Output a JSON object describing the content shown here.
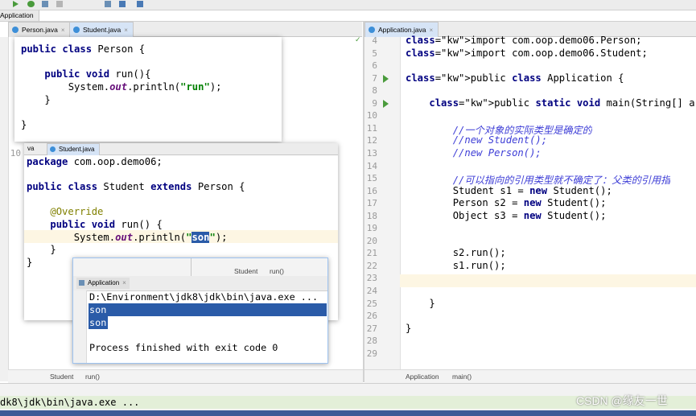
{
  "toolbar": {
    "app_label": "Application"
  },
  "left_tabs": [
    "Person.java",
    "Student.java"
  ],
  "right_tab": "Application.java",
  "person_popup": {
    "lines": [
      "public class Person {",
      "",
      "    public void run(){",
      "        System.out.println(\"run\");",
      "    }",
      "",
      "}"
    ]
  },
  "student_popup": {
    "tabs": [
      "va",
      "Student.java"
    ],
    "lines": [
      "package com.oop.demo06;",
      "",
      "public class Student extends Person {",
      "",
      "    @Override",
      "    public void run() {",
      "        System.out.println(\"son\");",
      "    }",
      "}"
    ]
  },
  "left_gutter_number": "10",
  "run_panel": {
    "crumb_student": "Student",
    "crumb_run": "run()",
    "tab": "Application",
    "lines": [
      "D:\\Environment\\jdk8\\jdk\\bin\\java.exe ...",
      "son",
      "son",
      "",
      "Process finished with exit code 0"
    ]
  },
  "left_breadcrumb": {
    "class": "Student",
    "method": "run()"
  },
  "right_editor": {
    "line_numbers": [
      "4",
      "5",
      "6",
      "7",
      "8",
      "9",
      "10",
      "11",
      "12",
      "13",
      "14",
      "15",
      "16",
      "17",
      "18",
      "19",
      "20",
      "21",
      "22",
      "23",
      "24",
      "25",
      "26",
      "27",
      "28",
      "29"
    ],
    "lines": [
      "import com.oop.demo06.Person;",
      "import com.oop.demo06.Student;",
      "",
      "public class Application {",
      "",
      "    public static void main(String[] args) {",
      "",
      "        //一个对象的实际类型是确定的",
      "        //new Student();",
      "        //new Person();",
      "",
      "        //可以指向的引用类型就不确定了：父类的引用指",
      "        Student s1 = new Student();",
      "        Person s2 = new Student();",
      "        Object s3 = new Student();",
      "",
      "",
      "        s2.run();",
      "        s1.run();",
      "",
      "",
      "    }",
      "",
      "}",
      "",
      ""
    ]
  },
  "right_breadcrumb": {
    "class": "Application",
    "method": "main()"
  },
  "bottom_bar": {
    "text": "dk8\\jdk\\bin\\java.exe ..."
  },
  "watermark": "CSDN @缘友一世"
}
